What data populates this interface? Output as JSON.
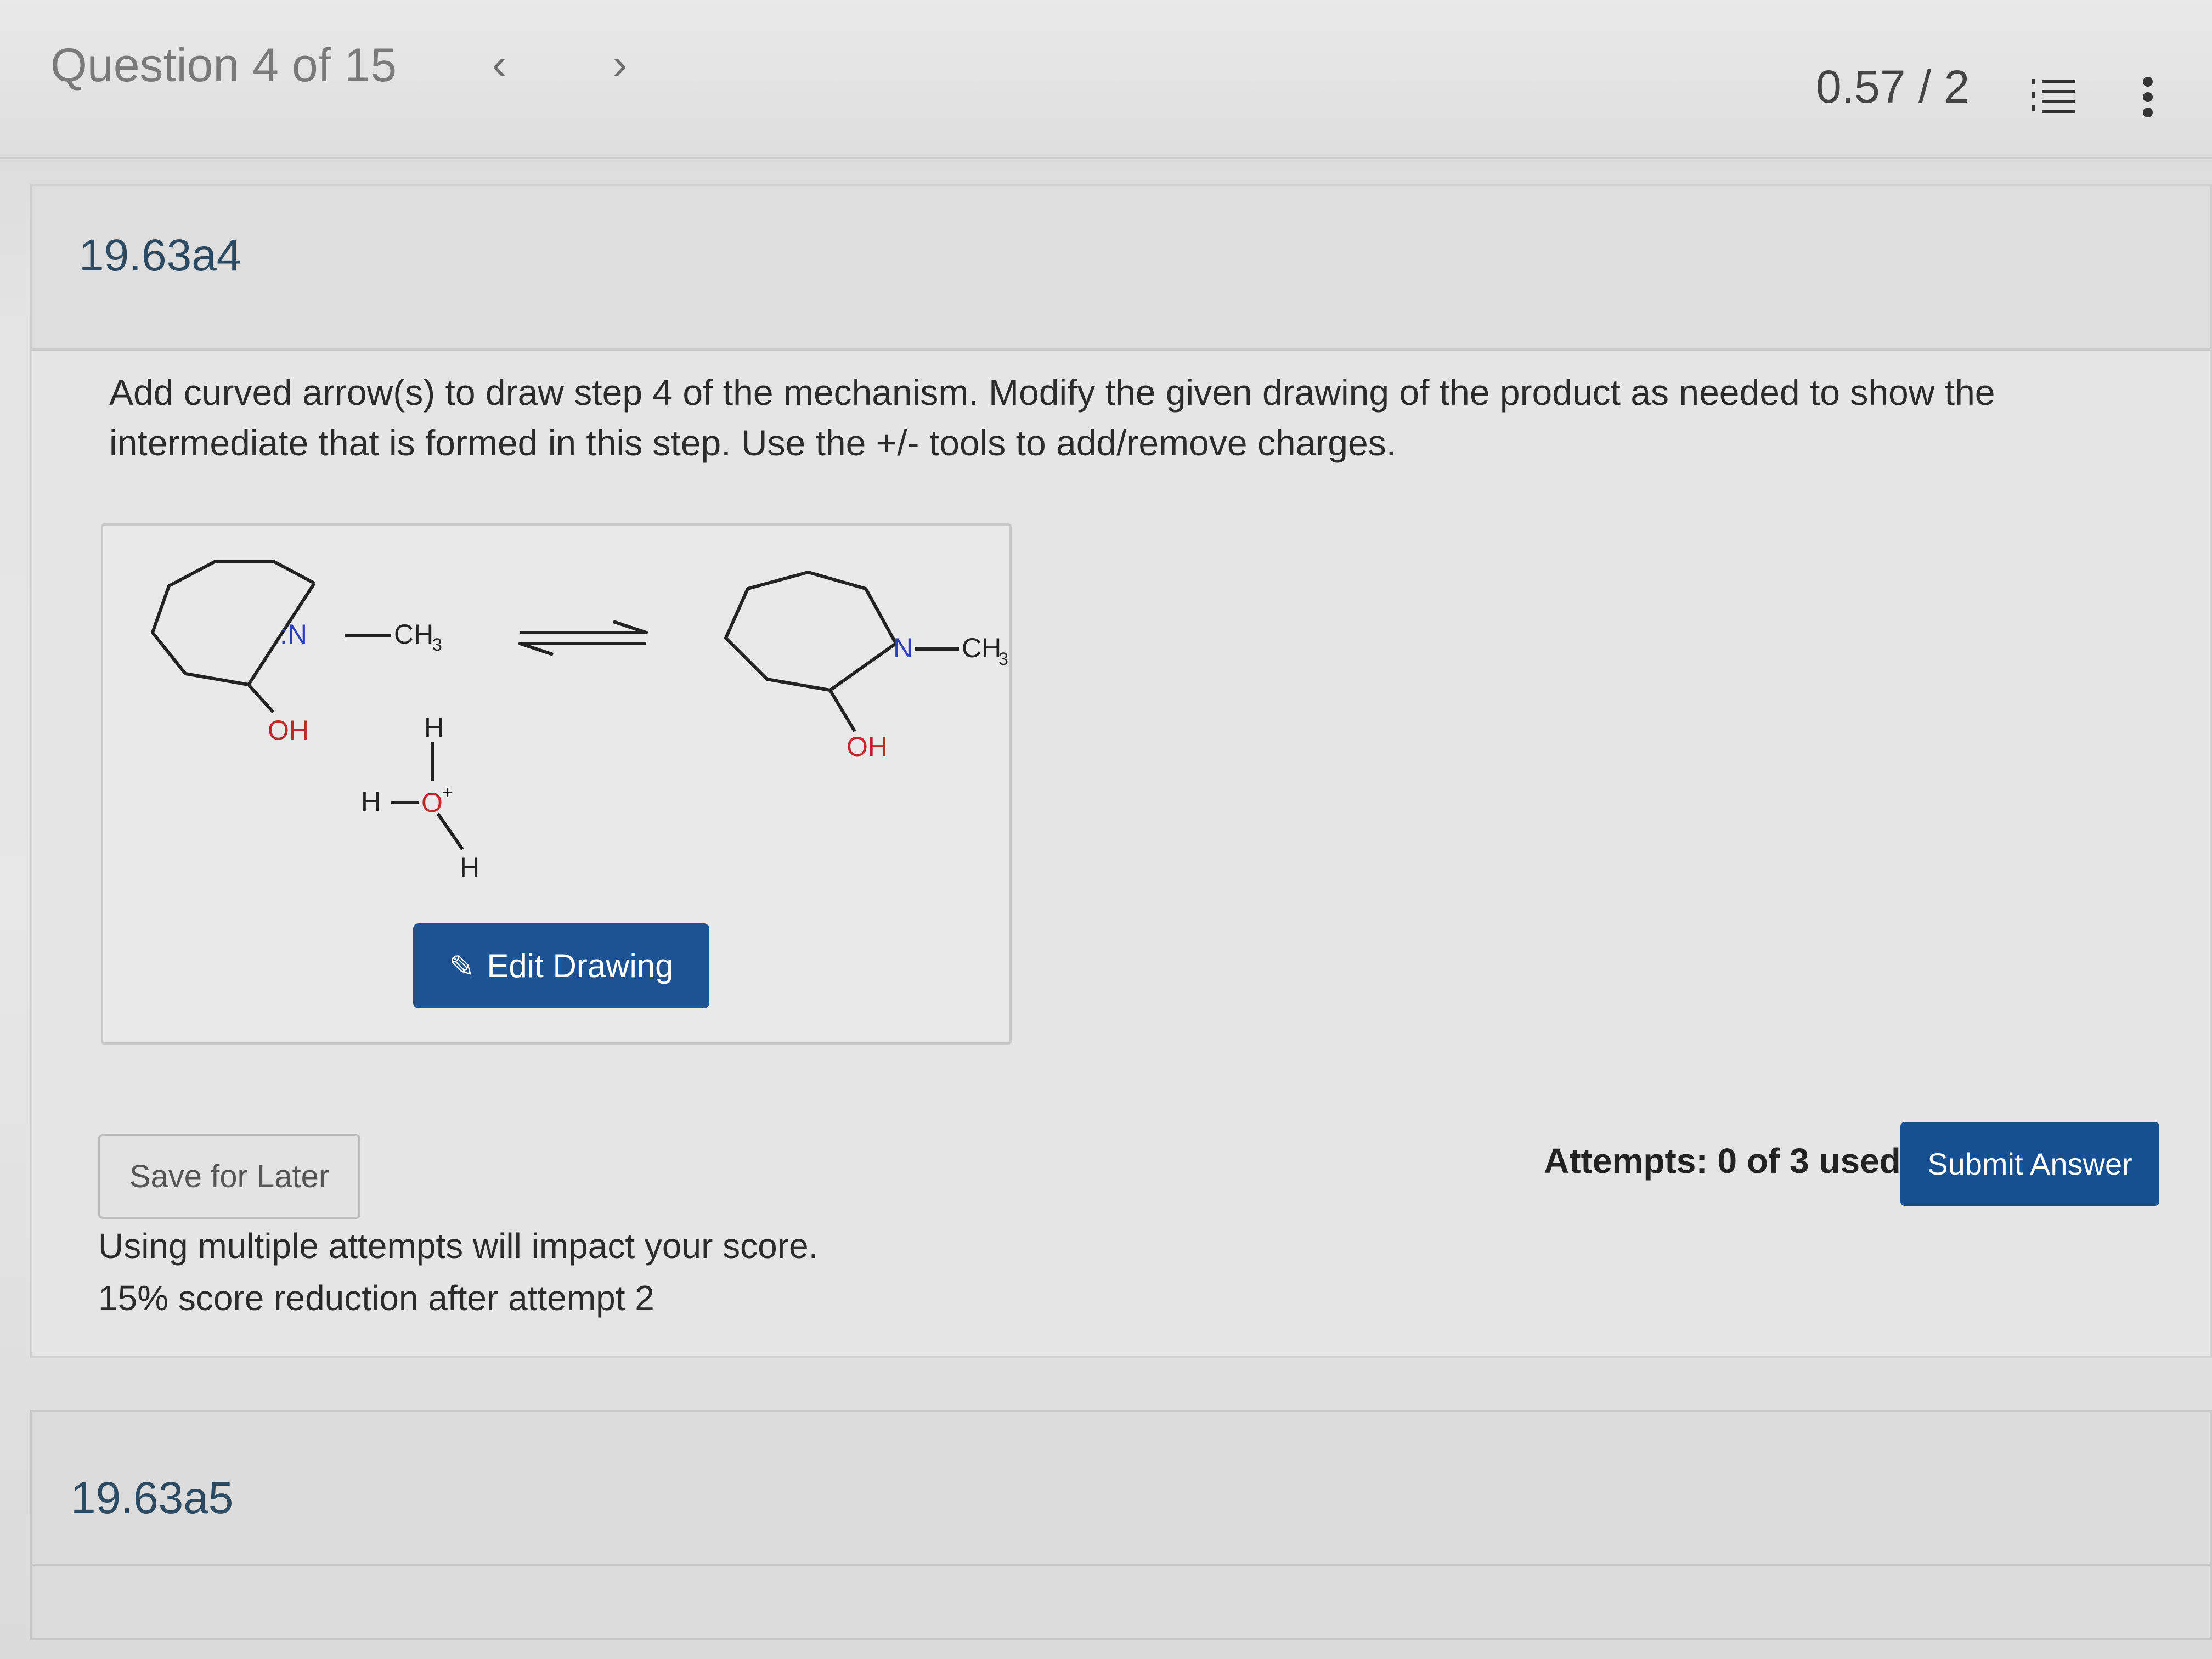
{
  "header": {
    "question_progress": "Question 4 of 15",
    "prev_icon": "chevron-left-icon",
    "next_icon": "chevron-right-icon",
    "score": "0.57 / 2",
    "list_icon": "numbered-list-icon",
    "menu_icon": "more-vertical-icon"
  },
  "question": {
    "id": "19.63a4",
    "prompt": "Add curved arrow(s) to draw step 4 of the mechanism. Modify the given drawing of the product as needed to show the intermediate that is formed in this step. Use the +/- tools to add/remove charges.",
    "drawing": {
      "reactant_n_label": ":N",
      "reactant_methyl": "CH",
      "methyl_subscript": "3",
      "reactant_oh": "OH",
      "water_h_top": "H",
      "water_h_left": "H",
      "water_o": "O",
      "water_charge": "+",
      "water_h_bottom": "H",
      "product_n_label": "N",
      "product_methyl": "CH",
      "product_oh": "OH"
    },
    "edit_button": "Edit Drawing",
    "edit_icon": "pencil-icon",
    "save_button": "Save for Later",
    "attempts": "Attempts: 0 of 3 used",
    "submit_button": "Submit Answer",
    "warning_line1": "Using multiple attempts will impact your score.",
    "warning_line2": "15% score reduction after attempt 2"
  },
  "next_question": {
    "id": "19.63a5"
  },
  "colors": {
    "primary_button": "#1d5293",
    "question_id": "#2d4a63",
    "nitrogen": "#2a3fb8",
    "oxygen": "#c0262b"
  }
}
